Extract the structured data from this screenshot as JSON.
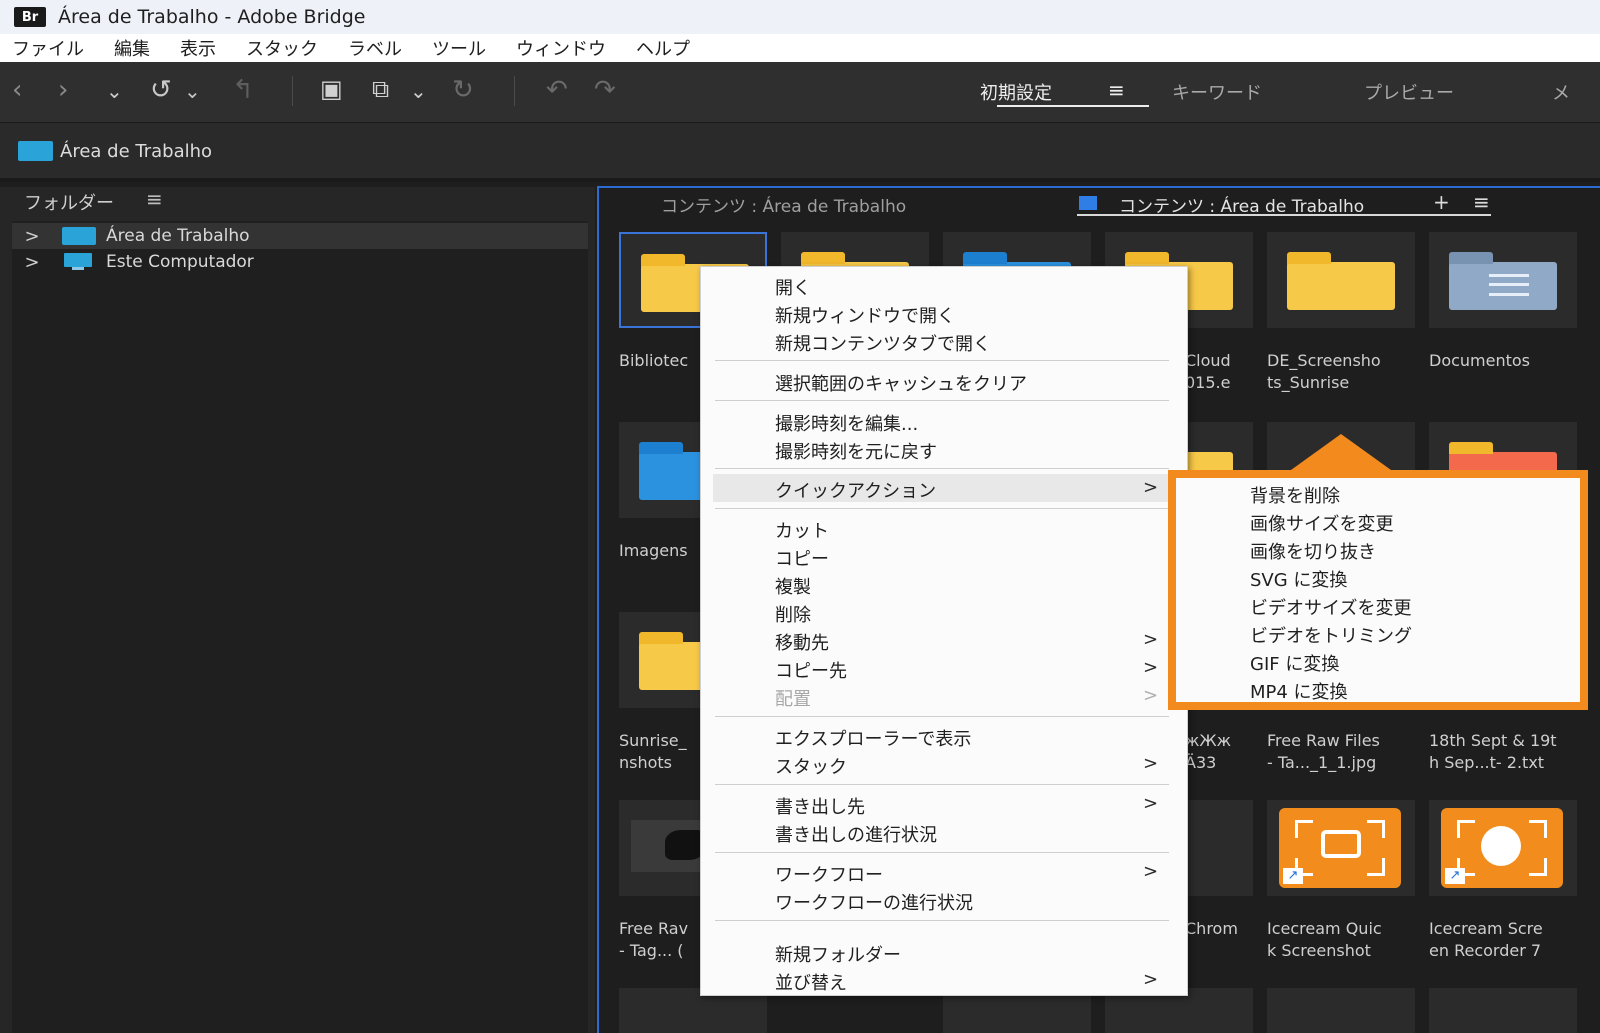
{
  "window": {
    "app_badge": "Br",
    "title": "Área de Trabalho - Adobe Bridge"
  },
  "menubar": [
    "ファイル",
    "編集",
    "表示",
    "スタック",
    "ラベル",
    "ツール",
    "ウィンドウ",
    "ヘルプ"
  ],
  "toolbar": {
    "workspaces": [
      "初期設定",
      "キーワード",
      "プレビュー",
      "メ"
    ],
    "active_workspace": "初期設定"
  },
  "pathbar": {
    "location": "Área de Trabalho"
  },
  "folders_panel": {
    "title": "フォルダー",
    "tree": [
      {
        "label": "Área de Trabalho",
        "icon": "folder-icon",
        "selected": true
      },
      {
        "label": "Este Computador",
        "icon": "computer-icon",
        "selected": false
      }
    ]
  },
  "content_panel": {
    "tabs": [
      "コンテンツ : Área de Trabalho",
      "コンテンツ : Área de Trabalho"
    ],
    "items": [
      {
        "caption": "Bibliotec",
        "icon": "folder-icon"
      },
      {
        "caption": "",
        "icon": "folder-icon"
      },
      {
        "caption": "",
        "icon": "folder-blue-icon"
      },
      {
        "caption": "Cloud\n015.e",
        "icon": "folder-icon"
      },
      {
        "caption": "DE_Screensho\nts_Sunrise",
        "icon": "folder-icon"
      },
      {
        "caption": "Documentos",
        "icon": "documents-folder-icon"
      },
      {
        "caption": "Imagens",
        "icon": "images-folder-icon"
      },
      {
        "caption": "Sunrise_\nnshots",
        "icon": "folder-icon"
      },
      {
        "caption": "жЖж\nÄ33",
        "icon": "file-icon"
      },
      {
        "caption": "Free Raw Files\n- Ta..._1_1.jpg",
        "icon": "image-file-icon"
      },
      {
        "caption": "18th Sept & 19t\nh Sep...t- 2.txt",
        "icon": "text-file-icon"
      },
      {
        "caption": "Free Rav\n- Tag... (",
        "icon": "image-thumbnail"
      },
      {
        "caption": "Chrom",
        "icon": "chrome-icon"
      },
      {
        "caption": "Icecream Quic\nk Screenshot",
        "icon": "icecream-screenshot-icon"
      },
      {
        "caption": "Icecream Scre\nen Recorder 7",
        "icon": "icecream-recorder-icon"
      }
    ]
  },
  "context_menu": {
    "items": [
      {
        "label": "開く"
      },
      {
        "label": "新規ウィンドウで開く"
      },
      {
        "label": "新規コンテンツタブで開く"
      },
      {
        "label": "選択範囲のキャッシュをクリア"
      },
      {
        "label": "撮影時刻を編集..."
      },
      {
        "label": "撮影時刻を元に戻す"
      },
      {
        "label": "クイックアクション",
        "submenu": true,
        "highlighted": true
      },
      {
        "label": "カット"
      },
      {
        "label": "コピー"
      },
      {
        "label": "複製"
      },
      {
        "label": "削除"
      },
      {
        "label": "移動先",
        "submenu": true
      },
      {
        "label": "コピー先",
        "submenu": true
      },
      {
        "label": "配置",
        "submenu": true,
        "disabled": true
      },
      {
        "label": "エクスプローラーで表示"
      },
      {
        "label": "スタック",
        "submenu": true
      },
      {
        "label": "書き出し先",
        "submenu": true
      },
      {
        "label": "書き出しの進行状況"
      },
      {
        "label": "ワークフロー",
        "submenu": true
      },
      {
        "label": "ワークフローの進行状況"
      },
      {
        "label": "新規フォルダー"
      },
      {
        "label": "並び替え",
        "submenu": true
      }
    ],
    "arrow": ">"
  },
  "quick_actions_submenu": {
    "items": [
      "背景を削除",
      "画像サイズを変更",
      "画像を切り抜き",
      "SVG に変換",
      "ビデオサイズを変更",
      "ビデオをトリミング",
      "GIF に変換",
      "MP4 に変換"
    ],
    "highlight_color": "#f28a1e"
  },
  "colors": {
    "folder_yellow": "#f7c948",
    "selection_blue": "#3b74d8",
    "accent_orange": "#f28a1e",
    "tree_folder": "#2aa4d8"
  }
}
